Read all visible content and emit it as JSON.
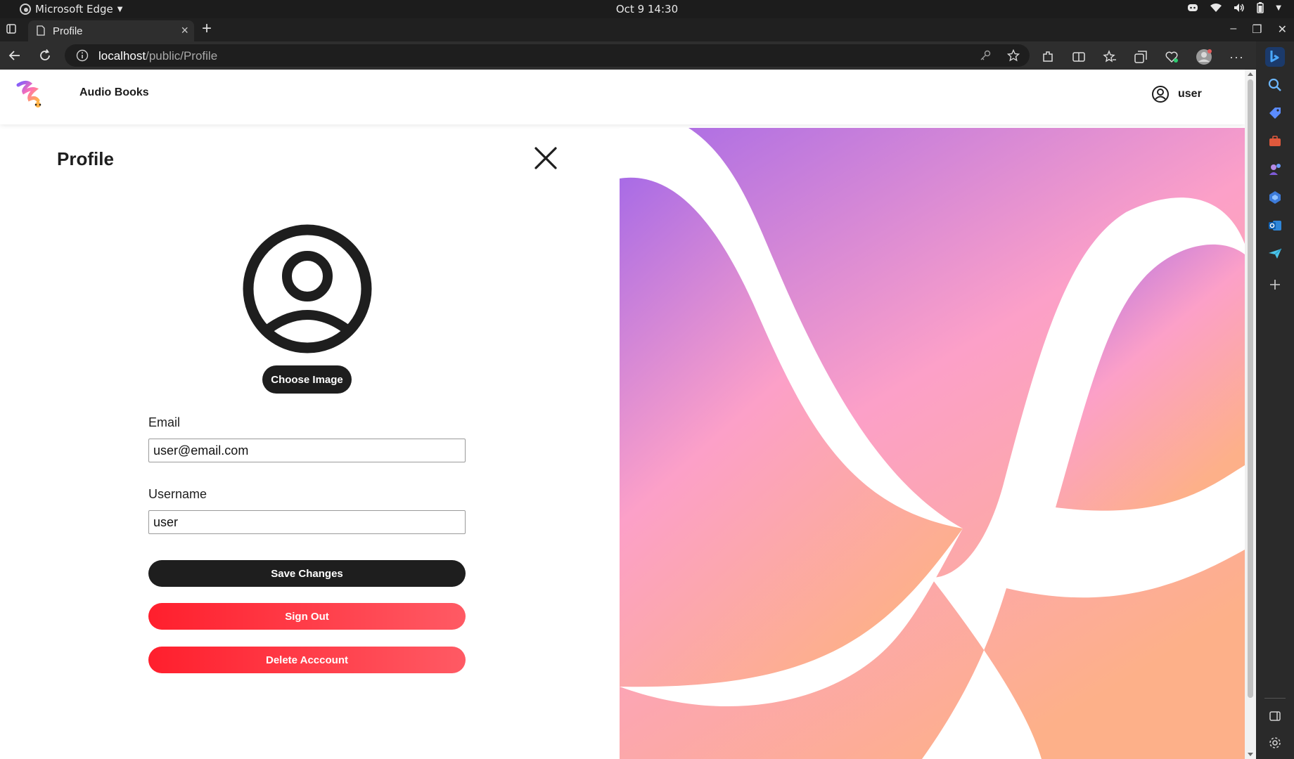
{
  "os": {
    "app_name": "Microsoft Edge",
    "clock": "Oct 9  14:30"
  },
  "browser": {
    "tab_title": "Profile",
    "url_host": "localhost",
    "url_path": "/public/Profile"
  },
  "app": {
    "title": "Audio Books",
    "username": "user"
  },
  "profile": {
    "heading": "Profile",
    "choose_image_label": "Choose Image",
    "email_label": "Email",
    "email_value": "user@email.com",
    "username_label": "Username",
    "username_value": "user",
    "save_label": "Save Changes",
    "sign_out_label": "Sign Out",
    "delete_label": "Delete Acccount"
  },
  "colors": {
    "primary_dark": "#1e1e1e",
    "danger": "#ff1f2d",
    "gradient_top": "#a86be6",
    "gradient_mid": "#fca0c8",
    "gradient_bottom": "#fdb089"
  }
}
